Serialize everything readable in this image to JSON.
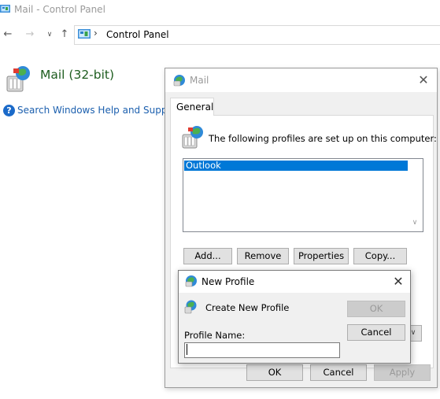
{
  "control_panel": {
    "window_title": "Mail - Control Panel",
    "address": "Control Panel",
    "heading": "Mail (32-bit)",
    "help_link": "Search Windows Help and Support f"
  },
  "mail_dialog": {
    "title": "Mail",
    "tab": "General",
    "profiles_text": "The following profiles are set up on this computer:",
    "profiles": [
      "Outlook"
    ],
    "buttons": {
      "add": "Add...",
      "remove": "Remove",
      "properties": "Properties",
      "copy": "Copy...",
      "ok": "OK",
      "cancel": "Cancel",
      "apply": "Apply"
    }
  },
  "new_profile_dialog": {
    "title": "New Profile",
    "create_text": "Create New Profile",
    "ok": "OK",
    "cancel": "Cancel",
    "profile_name_label": "Profile Name:",
    "profile_name_value": ""
  },
  "icons": {
    "close": "close-icon",
    "back": "arrow-left-icon",
    "forward": "arrow-right-icon",
    "up": "arrow-up-icon",
    "help": "help-icon",
    "mail": "mail-icon"
  },
  "colors": {
    "selection": "#0078d7",
    "heading_green": "#1e5d1f",
    "link_blue": "#1b5fae"
  }
}
